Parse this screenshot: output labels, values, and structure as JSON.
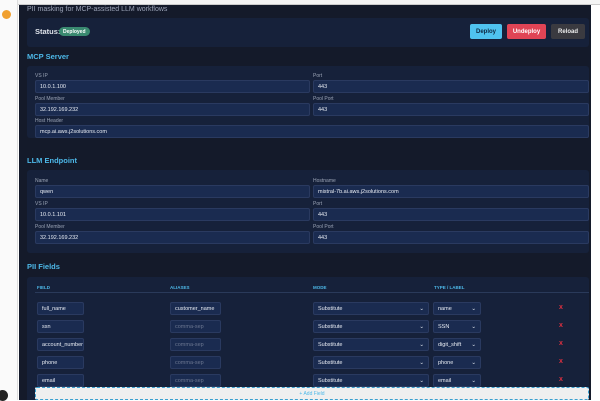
{
  "subtitle": "PII masking for MCP-assisted LLM workflows",
  "status": {
    "label": "Status:",
    "badge": "Deployed",
    "deploy": "Deploy",
    "undeploy": "Undeploy",
    "reload": "Reload"
  },
  "mcp": {
    "title": "MCP Server",
    "vs_ip_label": "VS IP",
    "vs_ip": "10.0.1.100",
    "port_label": "Port",
    "port": "443",
    "pool_member_label": "Pool Member",
    "pool_member": "32.192.169.232",
    "pool_port_label": "Pool Port",
    "pool_port": "443",
    "host_header_label": "Host Header",
    "host_header": "mcp.ai.aws.j2solutions.com"
  },
  "llm": {
    "title": "LLM Endpoint",
    "name_label": "Name",
    "name": "qwen",
    "hostname_label": "Hostname",
    "hostname": "mistral-7b.ai.aws.j2solutions.com",
    "vs_ip_label": "VS IP",
    "vs_ip": "10.0.1.101",
    "port_label": "Port",
    "port": "443",
    "pool_member_label": "Pool Member",
    "pool_member": "32.192.169.232",
    "pool_port_label": "Pool Port",
    "pool_port": "443"
  },
  "pii": {
    "title": "PII Fields",
    "headers": {
      "field": "FIELD",
      "aliases": "ALIASES",
      "mode": "MODE",
      "type": "TYPE / LABEL"
    },
    "alias_placeholder": "comma-sep",
    "remove": "x",
    "add": "+ Add Field",
    "rows": [
      {
        "field": "full_name",
        "aliases": "customer_name",
        "mode": "Substitute",
        "type": "name"
      },
      {
        "field": "ssn",
        "aliases": "",
        "mode": "Substitute",
        "type": "SSN"
      },
      {
        "field": "account_number",
        "aliases": "",
        "mode": "Substitute",
        "type": "digit_shift"
      },
      {
        "field": "phone",
        "aliases": "",
        "mode": "Substitute",
        "type": "phone"
      },
      {
        "field": "email",
        "aliases": "",
        "mode": "Substitute",
        "type": "email"
      }
    ]
  }
}
